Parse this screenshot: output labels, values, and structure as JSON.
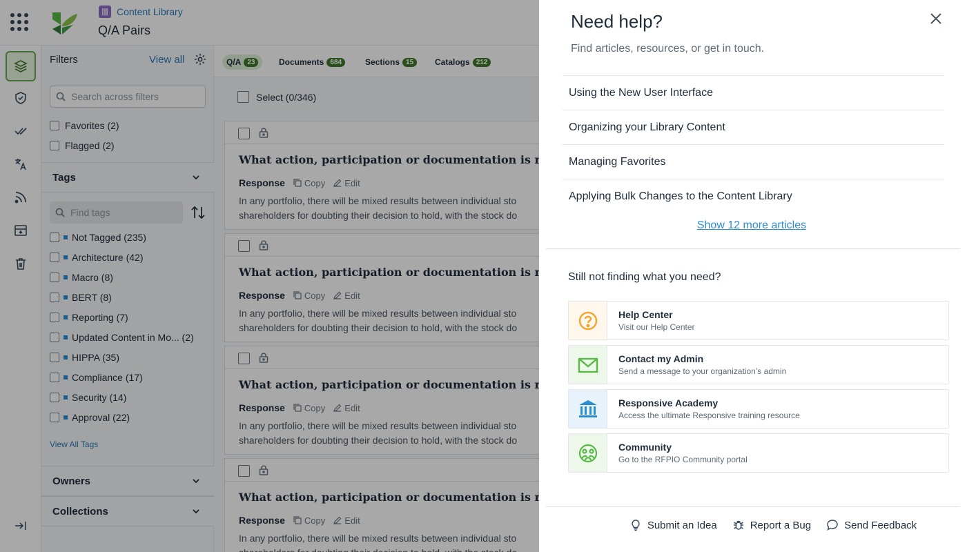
{
  "header": {
    "breadcrumb": "Content Library",
    "page_title": "Q/A Pairs"
  },
  "filters": {
    "title": "Filters",
    "view_all": "View all",
    "search_placeholder": "Search across filters",
    "quick": [
      "Favorites (2)",
      "Flagged (2)"
    ],
    "tags_title": "Tags",
    "tags_search_placeholder": "Find tags",
    "tags": [
      "Not Tagged (235)",
      "Architecture (42)",
      "Macro (8)",
      "BERT (8)",
      "Reporting (7)",
      "Updated Content in Mo... (2)",
      "HIPPA (35)",
      "Compliance (17)",
      "Security (14)",
      "Approval (22)"
    ],
    "view_all_tags": "View All Tags",
    "owners_title": "Owners",
    "collections_title": "Collections"
  },
  "tabs": [
    {
      "label": "Q/A",
      "count": "23"
    },
    {
      "label": "Documents",
      "count": "684"
    },
    {
      "label": "Sections",
      "count": "15"
    },
    {
      "label": "Catalogs",
      "count": "212"
    }
  ],
  "select_label": "Select (0/346)",
  "cards": [
    {
      "question": "What action, participation or documentation is required f",
      "response_label": "Response",
      "copy": "Copy",
      "edit": "Edit",
      "line1": "In any portfolio, there will be mixed results between individual sto",
      "line2": "shareholders for doubting their decision to hold, with the stock do"
    },
    {
      "question": "What action, participation or documentation is required f",
      "response_label": "Response",
      "copy": "Copy",
      "edit": "Edit",
      "line1": "In any portfolio, there will be mixed results between individual sto",
      "line2": "shareholders for doubting their decision to hold, with the stock do"
    },
    {
      "question": "What action, participation or documentation is required f",
      "response_label": "Response",
      "copy": "Copy",
      "edit": "Edit",
      "line1": "In any portfolio, there will be mixed results between individual sto",
      "line2": "shareholders for doubting their decision to hold, with the stock do"
    },
    {
      "question": "What action, participation or documentation is required f",
      "response_label": "Response",
      "copy": "Copy",
      "edit": "Edit",
      "line1": "In any portfolio, there will be mixed results between individual sto",
      "line2": "shareholders for doubting their decision to hold, with the stock do"
    }
  ],
  "help": {
    "title": "Need help?",
    "subtitle": "Find articles, resources, or get in touch.",
    "articles": [
      "Using the New User Interface",
      "Organizing your Library Content",
      "Managing Favorites",
      "Applying Bulk Changes to the Content Library"
    ],
    "show_more": "Show 12 more articles",
    "still_title": "Still not finding what you need?",
    "resources": [
      {
        "title": "Help Center",
        "desc": "Visit our Help Center",
        "icon": "question-icon",
        "color": "#f0a531",
        "bg": "#fff6ec"
      },
      {
        "title": "Contact my Admin",
        "desc": "Send a message to your organization’s admin",
        "icon": "envelope-icon",
        "color": "#58b947",
        "bg": "#eef8ea"
      },
      {
        "title": "Responsive Academy",
        "desc": "Access the ultimate Responsive training resource",
        "icon": "academy-icon",
        "color": "#2b8fd6",
        "bg": "#e8f2fb"
      },
      {
        "title": "Community",
        "desc": "Go to the RFPIO Community portal",
        "icon": "community-icon",
        "color": "#58b947",
        "bg": "#eef8ea"
      }
    ],
    "footer": {
      "idea": "Submit an Idea",
      "bug": "Report a Bug",
      "feedback": "Send Feedback"
    }
  }
}
